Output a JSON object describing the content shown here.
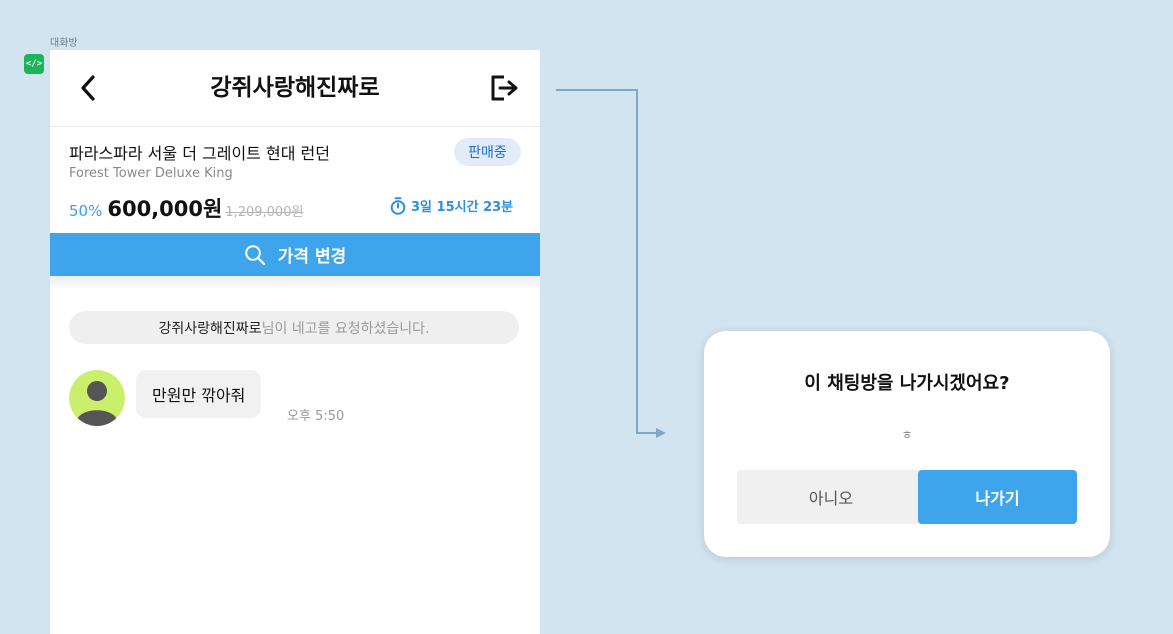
{
  "frame": {
    "label": "대화방",
    "code_badge": "</>"
  },
  "header": {
    "title": "강쥐사랑해진짜로",
    "back_icon": "chevron-left-icon",
    "exit_icon": "exit-icon"
  },
  "product": {
    "name": "파라스파라 서울 더 그레이트 현대 런던",
    "subtitle": "Forest Tower Deluxe King",
    "status": "판매중",
    "discount": "50%",
    "price": "600,000원",
    "original_price": "1,209,000원",
    "timer": "3일 15시간 23분"
  },
  "price_change_button": {
    "label": "가격 변경"
  },
  "chat": {
    "system_message": {
      "name": "강쥐사랑해진짜로",
      "text": "님이 네고를 요청하셨습니다."
    },
    "messages": [
      {
        "text": "만원만 깎아줘",
        "time": "오후 5:50"
      }
    ]
  },
  "dialog": {
    "title": "이 채팅방을 나가시겠어요?",
    "body": "ㅎ",
    "cancel_label": "아니오",
    "confirm_label": "나가기"
  },
  "colors": {
    "background": "#d2e4ef",
    "accent": "#3ea5ec",
    "badge_bg": "#e1ecf8",
    "badge_text": "#1f6fc4",
    "avatar_bg": "#c9ef6b",
    "code_badge": "#1bb45a"
  }
}
